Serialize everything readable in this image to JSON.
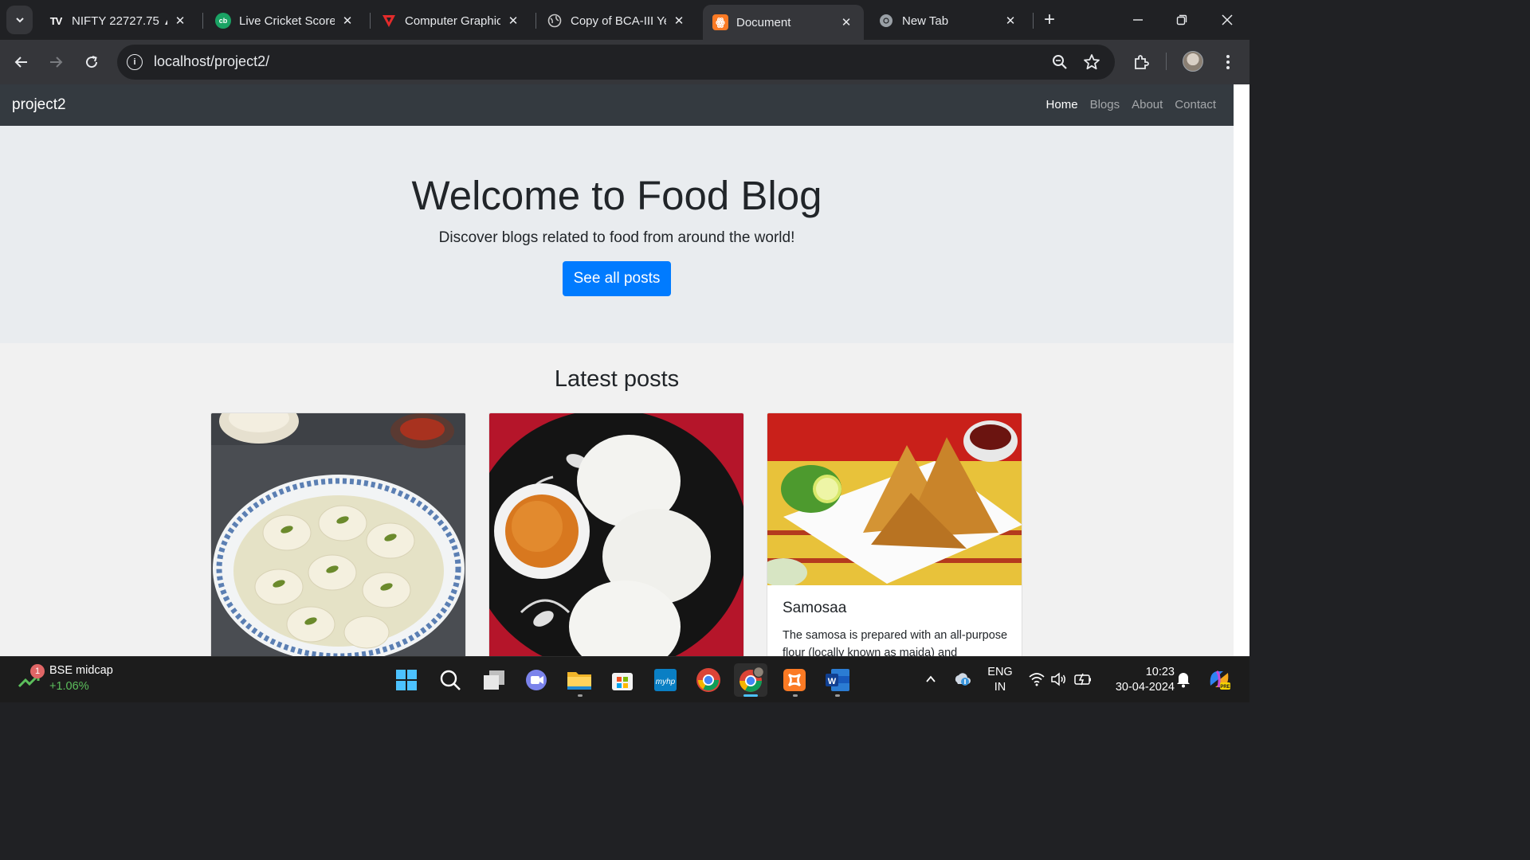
{
  "browser": {
    "tabs": [
      {
        "title": "NIFTY 22727.75 ▲",
        "icon": "tradingview-icon",
        "active": false
      },
      {
        "title": "Live Cricket Score,",
        "icon": "cricbuzz-icon",
        "active": false
      },
      {
        "title": "Computer Graphic",
        "icon": "testbook-icon",
        "active": false
      },
      {
        "title": "Copy of BCA-III Ye",
        "icon": "globe-icon",
        "active": false
      },
      {
        "title": "Document",
        "icon": "xampp-icon",
        "active": true
      },
      {
        "title": "New Tab",
        "icon": "chrome-icon",
        "active": false
      }
    ],
    "address": "localhost/project2/"
  },
  "site": {
    "brand": "project2",
    "nav": [
      {
        "label": "Home",
        "active": true
      },
      {
        "label": "Blogs",
        "active": false
      },
      {
        "label": "About",
        "active": false
      },
      {
        "label": "Contact",
        "active": false
      }
    ],
    "hero": {
      "title": "Welcome to Food Blog",
      "subtitle": "Discover blogs related to food from around the world!",
      "button": "See all posts"
    },
    "latest_title": "Latest posts",
    "posts": [
      {
        "image": "rasmalai-image",
        "title": "",
        "text": ""
      },
      {
        "image": "idli-image",
        "title": "",
        "text": ""
      },
      {
        "image": "samosa-image",
        "title": "Samosaa",
        "text": "The samosa is prepared with an all-purpose flour (locally known as maida) and"
      }
    ]
  },
  "taskbar": {
    "widget": {
      "badge": "1",
      "title": "BSE midcap",
      "value": "+1.06%"
    },
    "apps": [
      "windows-start-icon",
      "search-icon",
      "task-view-icon",
      "teams-icon",
      "file-explorer-icon",
      "microsoft-store-icon",
      "myhp-icon",
      "chrome-icon",
      "chrome-profile-icon",
      "xampp-icon",
      "word-icon"
    ],
    "lang": [
      "ENG",
      "IN"
    ],
    "time": "10:23",
    "date": "30-04-2024"
  },
  "colors": {
    "accent": "#007bff",
    "navbar": "#343a40",
    "jumbotron": "#e9ecef",
    "positive": "#5cbf5c"
  }
}
